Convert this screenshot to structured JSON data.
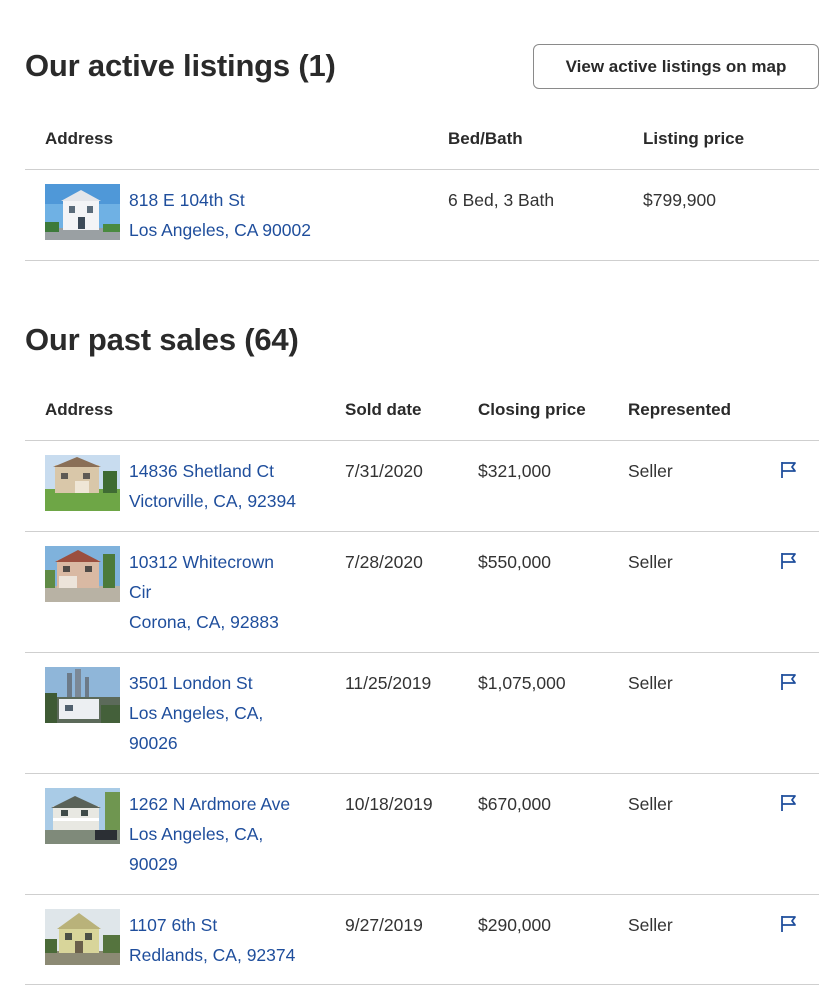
{
  "active": {
    "title": "Our active listings (1)",
    "map_button": "View active listings on map",
    "headers": {
      "address": "Address",
      "bedbath": "Bed/Bath",
      "price": "Listing price"
    },
    "rows": [
      {
        "street": "818 E 104th St",
        "city": "Los Angeles, CA 90002",
        "bedbath": "6 Bed, 3 Bath",
        "price": "$799,900"
      }
    ]
  },
  "past": {
    "title": "Our past sales (64)",
    "headers": {
      "address": "Address",
      "sold": "Sold date",
      "closing": "Closing price",
      "represented": "Represented"
    },
    "rows": [
      {
        "street": "14836 Shetland Ct",
        "city": "Victorville, CA, 92394",
        "sold": "7/31/2020",
        "price": "$321,000",
        "represented": "Seller"
      },
      {
        "street_1": "10312 Whitecrown",
        "street_2": "Cir",
        "city": "Corona, CA, 92883",
        "sold": "7/28/2020",
        "price": "$550,000",
        "represented": "Seller"
      },
      {
        "street": "3501 London St",
        "city_1": "Los Angeles, CA,",
        "city_2": "90026",
        "sold": "11/25/2019",
        "price": "$1,075,000",
        "represented": "Seller"
      },
      {
        "street": "1262 N Ardmore Ave",
        "city_1": "Los Angeles, CA,",
        "city_2": "90029",
        "sold": "10/18/2019",
        "price": "$670,000",
        "represented": "Seller"
      },
      {
        "street": "1107 6th St",
        "city": "Redlands, CA, 92374",
        "sold": "9/27/2019",
        "price": "$290,000",
        "represented": "Seller"
      }
    ]
  },
  "colors": {
    "link": "#1f4e9c",
    "text": "#2a2a2a",
    "rule": "#cfcfcf"
  },
  "icons": {
    "flag": "flag-icon"
  }
}
